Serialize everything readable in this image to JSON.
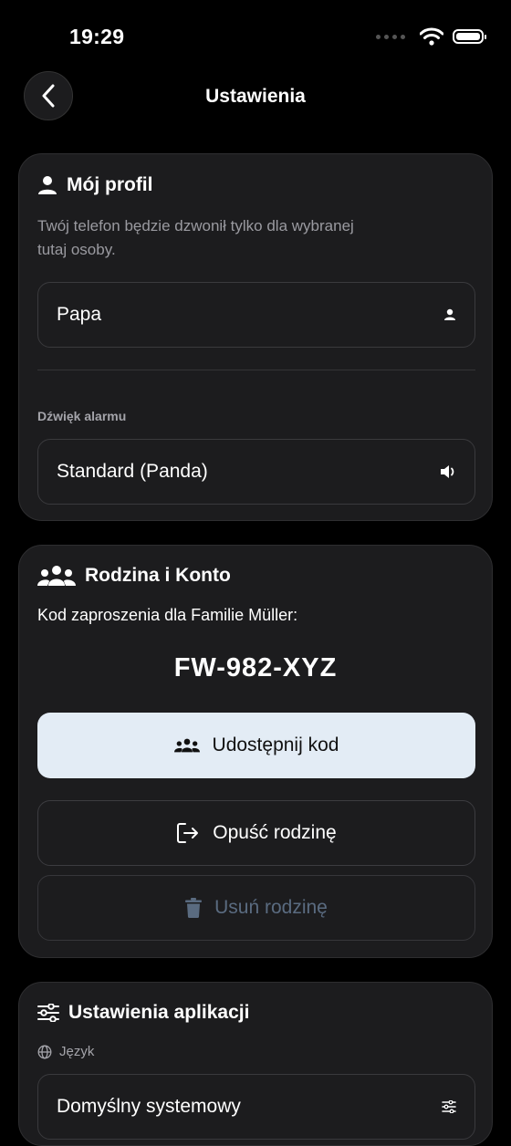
{
  "status_bar": {
    "time": "19:29"
  },
  "nav": {
    "title": "Ustawienia",
    "back_icon": "chevron-left-icon"
  },
  "profile": {
    "title": "Mój profil",
    "description_line1": "Twój telefon będzie dzwonił tylko dla wybranej",
    "description_line2": "tutaj osoby.",
    "person_value": "Papa",
    "alarm_label": "Dźwięk alarmu",
    "alarm_value": "Standard (Panda)"
  },
  "family": {
    "title": "Rodzina i Konto",
    "invite_text": "Kod zaproszenia dla Familie Müller:",
    "code": "FW-982-XYZ",
    "share_label": "Udostępnij kod",
    "leave_label": "Opuść rodzinę",
    "delete_label": "Usuń rodzinę"
  },
  "app_settings": {
    "title": "Ustawienia aplikacji",
    "language_label": "Język",
    "language_value": "Domyślny systemowy"
  },
  "colors": {
    "background": "#000000",
    "card": "#1c1c1e",
    "primary_button": "#e3ecf5",
    "disabled_text": "#5a6b80"
  }
}
